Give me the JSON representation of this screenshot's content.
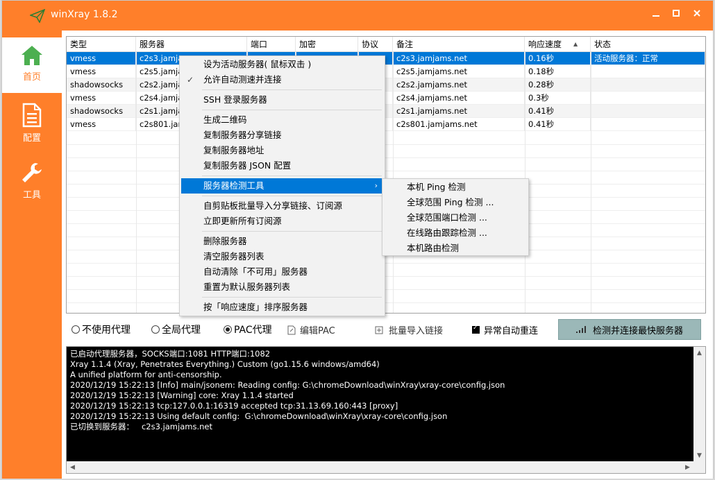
{
  "app": {
    "title": "winXray 1.8.2"
  },
  "sidebar": {
    "items": [
      {
        "label": "首页",
        "icon": "home-icon",
        "active": true
      },
      {
        "label": "配置",
        "icon": "document-icon",
        "active": false
      },
      {
        "label": "工具",
        "icon": "wrench-icon",
        "active": false
      }
    ]
  },
  "table": {
    "headers": [
      "类型",
      "服务器",
      "端口",
      "加密",
      "协议",
      "备注",
      "响应速度",
      "状态"
    ],
    "sort_indicator": "▲",
    "rows": [
      {
        "type": "vmess",
        "server": "c2s3.jamja",
        "remark": "c2s3.jamjams.net",
        "speed": "0.16秒",
        "status": "活动服务器：正常"
      },
      {
        "type": "vmess",
        "server": "c2s5.jamja",
        "remark": "c2s5.jamjams.net",
        "speed": "0.18秒",
        "status": ""
      },
      {
        "type": "shadowsocks",
        "server": "c2s2.jamja",
        "remark": "c2s2.jamjams.net",
        "speed": "0.28秒",
        "status": ""
      },
      {
        "type": "vmess",
        "server": "c2s4.jamja",
        "remark": "c2s4.jamjams.net",
        "speed": "0.3秒",
        "status": ""
      },
      {
        "type": "shadowsocks",
        "server": "c2s1.jamja",
        "remark": "c2s1.jamjams.net",
        "speed": "0.41秒",
        "status": ""
      },
      {
        "type": "vmess",
        "server": "c2s801.jam",
        "remark": "c2s801.jamjams.net",
        "speed": "0.41秒",
        "status": ""
      }
    ]
  },
  "context_menu": {
    "items": [
      "设为活动服务器( 鼠标双击 )",
      "允许自动测速并连接",
      "SSH 登录服务器",
      "生成二维码",
      "复制服务器分享链接",
      "复制服务器地址",
      "复制服务器 JSON 配置",
      "服务器检测工具",
      "自剪贴板批量导入分享链接、订阅源",
      "立即更新所有订阅源",
      "删除服务器",
      "清空服务器列表",
      "自动清除「不可用」服务器",
      "重置为默认服务器列表",
      "按「响应速度」排序服务器"
    ],
    "submenu_arrow": "›",
    "check_mark": "✓"
  },
  "submenu": {
    "items": [
      "本机 Ping 检测",
      "全球范围 Ping 检测 ...",
      "全球范围端口检测 ...",
      "在线路由跟踪检测 ...",
      "本机路由检测"
    ]
  },
  "options": {
    "no_proxy": "不使用代理",
    "global_proxy": "全局代理",
    "pac_proxy": "PAC代理",
    "edit_pac": "编辑PAC",
    "bulk_import": "批量导入链接",
    "auto_reconnect": "异常自动重连",
    "detect_button": "检测并连接最快服务器",
    "selected_mode": "pac_proxy"
  },
  "console": {
    "lines": [
      "已启动代理服务器，SOCKS端口:1081 HTTP端口:1082",
      "Xray 1.1.4 (Xray, Penetrates Everything.) Custom (go1.15.6 windows/amd64)",
      "A unified platform for anti-censorship.",
      "2020/12/19 15:22:13 [Info] main/jsonem: Reading config: G:\\chromeDownload\\winXray\\xray-core\\config.json",
      "2020/12/19 15:22:13 [Warning] core: Xray 1.1.4 started",
      "2020/12/19 15:22:13 tcp:127.0.0.1:16319 accepted tcp:31.13.69.160:443 [proxy]",
      "2020/12/19 15:22:13 Using default config:  G:\\chromeDownload\\winXray\\xray-core\\config.json",
      "已切换到服务器：   c2s3.jamjams.net"
    ]
  },
  "colors": {
    "accent": "#ff7f2a",
    "selection": "#0078d7",
    "detect_button": "#9bb8b8"
  }
}
